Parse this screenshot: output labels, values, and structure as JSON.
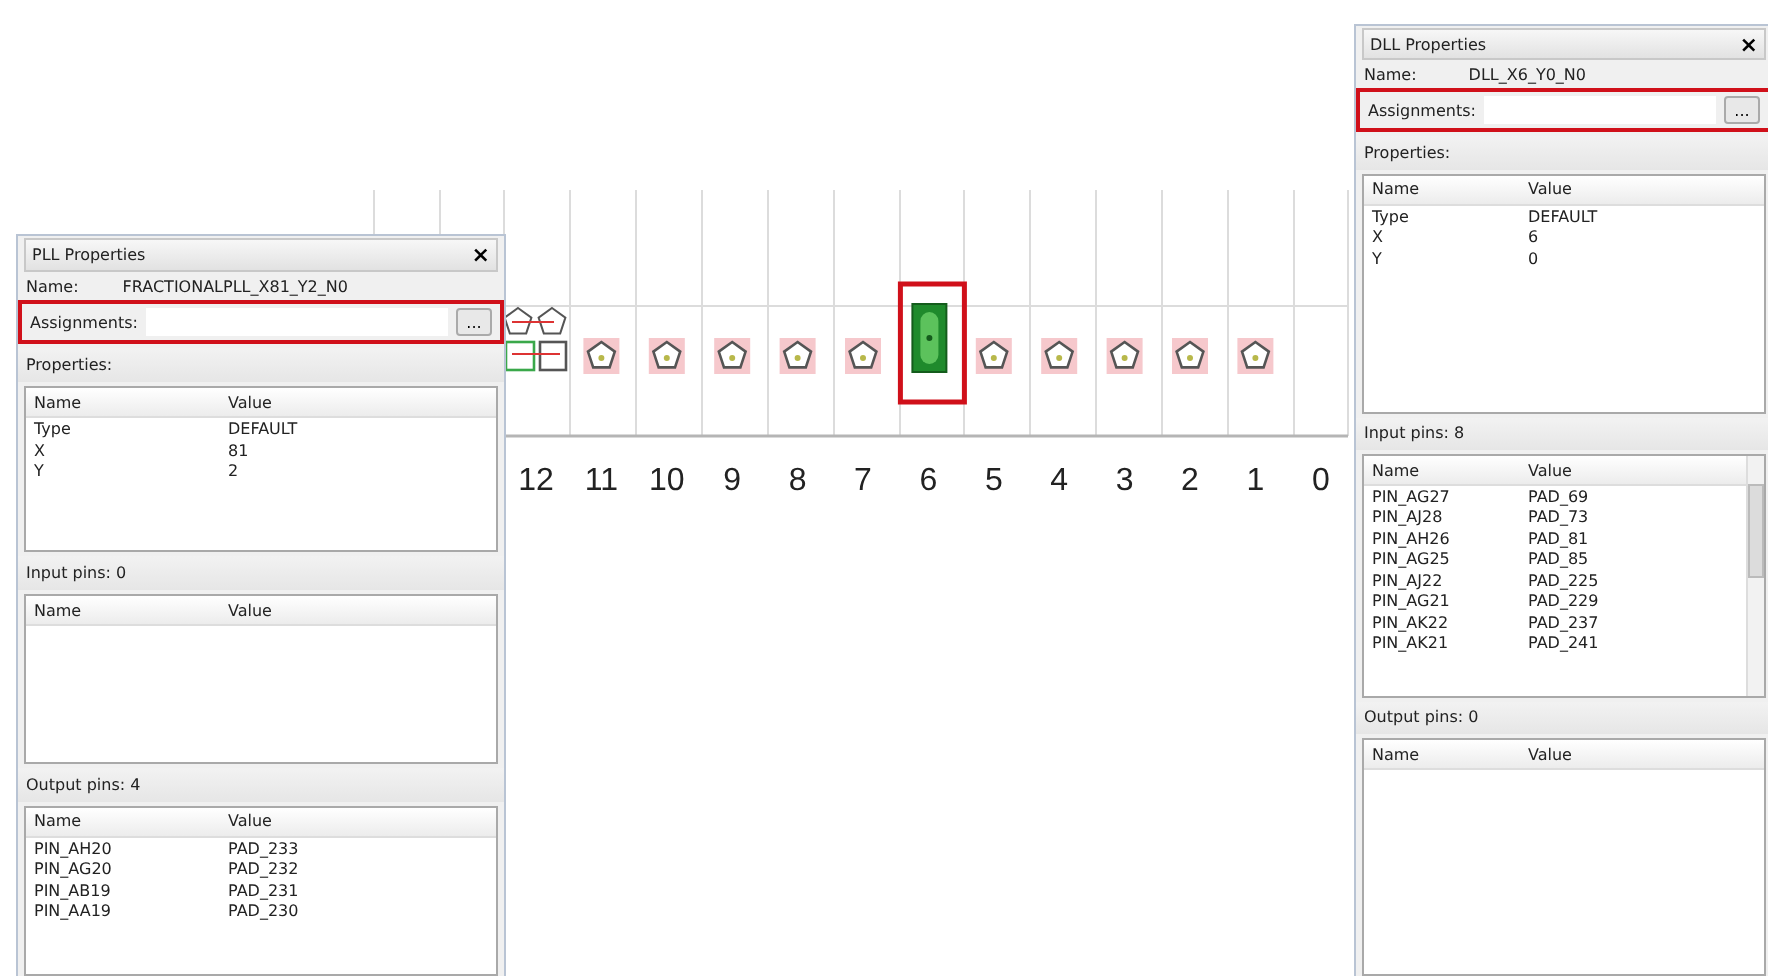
{
  "canvas": {
    "columns": [
      "12",
      "11",
      "10",
      "9",
      "8",
      "7",
      "6",
      "5",
      "4",
      "3",
      "2",
      "1",
      "0"
    ],
    "cells": [
      {
        "kind": "pll",
        "selected": false
      },
      {
        "kind": "pad",
        "selected": false
      },
      {
        "kind": "pad",
        "selected": false
      },
      {
        "kind": "pad",
        "selected": false
      },
      {
        "kind": "pad",
        "selected": false
      },
      {
        "kind": "pad",
        "selected": false
      },
      {
        "kind": "dll",
        "selected": true
      },
      {
        "kind": "pad",
        "selected": false
      },
      {
        "kind": "pad",
        "selected": false
      },
      {
        "kind": "pad",
        "selected": false
      },
      {
        "kind": "pad",
        "selected": false
      },
      {
        "kind": "pad",
        "selected": false
      }
    ]
  },
  "panels": [
    {
      "title": "PLL Properties",
      "close": "×",
      "name_label": "Name:",
      "name_value": "FRACTIONALPLL_X81_Y2_N0",
      "assignments_label": "Assignments:",
      "assignments_highlighted": true,
      "browse": "...",
      "sections": [
        {
          "label": "Properties:",
          "columns": [
            "Name",
            "Value"
          ],
          "rows": [
            [
              "Type",
              "DEFAULT"
            ],
            [
              "X",
              "81"
            ],
            [
              "Y",
              "2"
            ]
          ]
        },
        {
          "label": "Input pins: 0",
          "columns": [
            "Name",
            "Value"
          ]
        },
        {
          "label": "Output pins: 4",
          "columns": [
            "Name",
            "Value"
          ],
          "rows": [
            [
              "PIN_AH20",
              "PAD_233"
            ],
            [
              "PIN_AG20",
              "PAD_232"
            ],
            [
              "PIN_AB19",
              "PAD_231"
            ],
            [
              "PIN_AA19",
              "PAD_230"
            ]
          ]
        }
      ]
    },
    {
      "title": "DLL Properties",
      "close": "×",
      "name_label": "Name:",
      "name_value": "DLL_X6_Y0_N0",
      "assignments_label": "Assignments:",
      "assignments_highlighted": true,
      "browse": "...",
      "sections": [
        {
          "label": "Properties:",
          "columns": [
            "Name",
            "Value"
          ],
          "rows": [
            [
              "Type",
              "DEFAULT"
            ],
            [
              "X",
              "6"
            ],
            [
              "Y",
              "0"
            ]
          ]
        },
        {
          "label": "Input pins: 8",
          "columns": [
            "Name",
            "Value"
          ],
          "rows": [
            [
              "PIN_AG27",
              "PAD_69"
            ],
            [
              "PIN_AJ28",
              "PAD_73"
            ],
            [
              "PIN_AH26",
              "PAD_81"
            ],
            [
              "PIN_AG25",
              "PAD_85"
            ],
            [
              "PIN_AJ22",
              "PAD_225"
            ],
            [
              "PIN_AG21",
              "PAD_229"
            ],
            [
              "PIN_AK22",
              "PAD_237"
            ],
            [
              "PIN_AK21",
              "PAD_241"
            ]
          ]
        },
        {
          "label": "Output pins: 0",
          "columns": [
            "Name",
            "Value"
          ]
        }
      ]
    }
  ]
}
